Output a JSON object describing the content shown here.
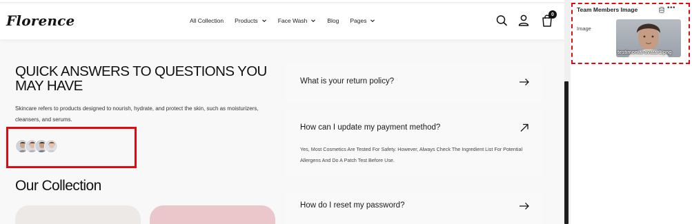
{
  "header": {
    "logo": "Florence",
    "nav": [
      {
        "label": "All Collection",
        "has_dropdown": false
      },
      {
        "label": "Products",
        "has_dropdown": true
      },
      {
        "label": "Face Wash",
        "has_dropdown": true
      },
      {
        "label": "Blog",
        "has_dropdown": false
      },
      {
        "label": "Pages",
        "has_dropdown": true
      }
    ],
    "cart_count": "0",
    "icons": [
      "search-icon",
      "user-icon",
      "cart-icon"
    ]
  },
  "faq_section": {
    "title": "QUICK ANSWERS TO QUESTIONS YOU MAY HAVE",
    "description": "Skincare refers to products designed to nourish, hydrate, and protect the skin, such as moisturizers, cleansers, and serums.",
    "avatar_count": 4,
    "items": [
      {
        "question": "What is your return policy?",
        "answer": "",
        "expanded": false
      },
      {
        "question": "How can I update my payment method?",
        "answer": "Yes, Most Cosmetics Are Tested For Safety. However, Always Check The Ingredient List For Potential Allergens And Do A Patch Test Before Use.",
        "expanded": true
      },
      {
        "question": "How do I reset my password?",
        "answer": "",
        "expanded": false
      }
    ]
  },
  "collection": {
    "title": "Our Collection"
  },
  "panel": {
    "title": "Team Members Image",
    "field_label": "Image",
    "image_filename": "testimonial-avatar1.png"
  },
  "colors": {
    "highlight": "#e3070e",
    "page_bg": "#f8f8f9",
    "text": "#111111"
  }
}
